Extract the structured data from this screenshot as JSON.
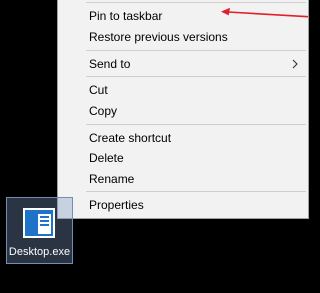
{
  "context_menu": {
    "pin_label": "Pin to taskbar",
    "restore_label": "Restore previous versions",
    "send_to_label": "Send to",
    "cut_label": "Cut",
    "copy_label": "Copy",
    "create_shortcut_label": "Create shortcut",
    "delete_label": "Delete",
    "rename_label": "Rename",
    "properties_label": "Properties",
    "submenu_icon": "chevron-right-icon"
  },
  "annotation": {
    "arrow_icon": "red-arrow-icon",
    "arrow_color": "#e0202a"
  },
  "desktop_item": {
    "label": "Desktop.exe",
    "icon": "application-window-icon",
    "accent_color": "#1e73c9"
  }
}
